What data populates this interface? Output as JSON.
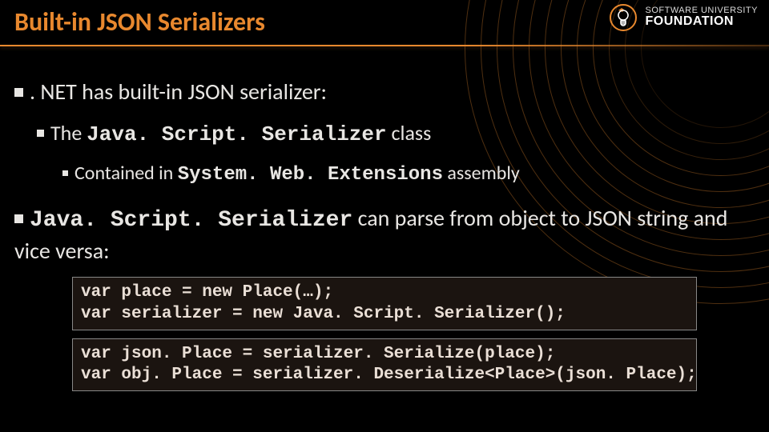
{
  "title": "Built-in JSON Serializers",
  "logo": {
    "top": "SOFTWARE UNIVERSITY",
    "bottom": "FOUNDATION"
  },
  "bullets": {
    "b0": ". NET has built-in JSON serializer:",
    "b1_pre": "The ",
    "b1_code": "Java. Script. Serializer",
    "b1_post": " class",
    "b2_pre": "Contained in ",
    "b2_code": "System. Web. Extensions",
    "b2_post": " assembly",
    "b3_code": "Java. Script. Serializer",
    "b3_post": " can parse from object to JSON string and vice versa:"
  },
  "code": {
    "block1": "var place = new Place(…);\nvar serializer = new Java. Script. Serializer();",
    "block2": "var json. Place = serializer. Serialize(place);\nvar obj. Place = serializer. Deserialize<Place>(json. Place);"
  }
}
